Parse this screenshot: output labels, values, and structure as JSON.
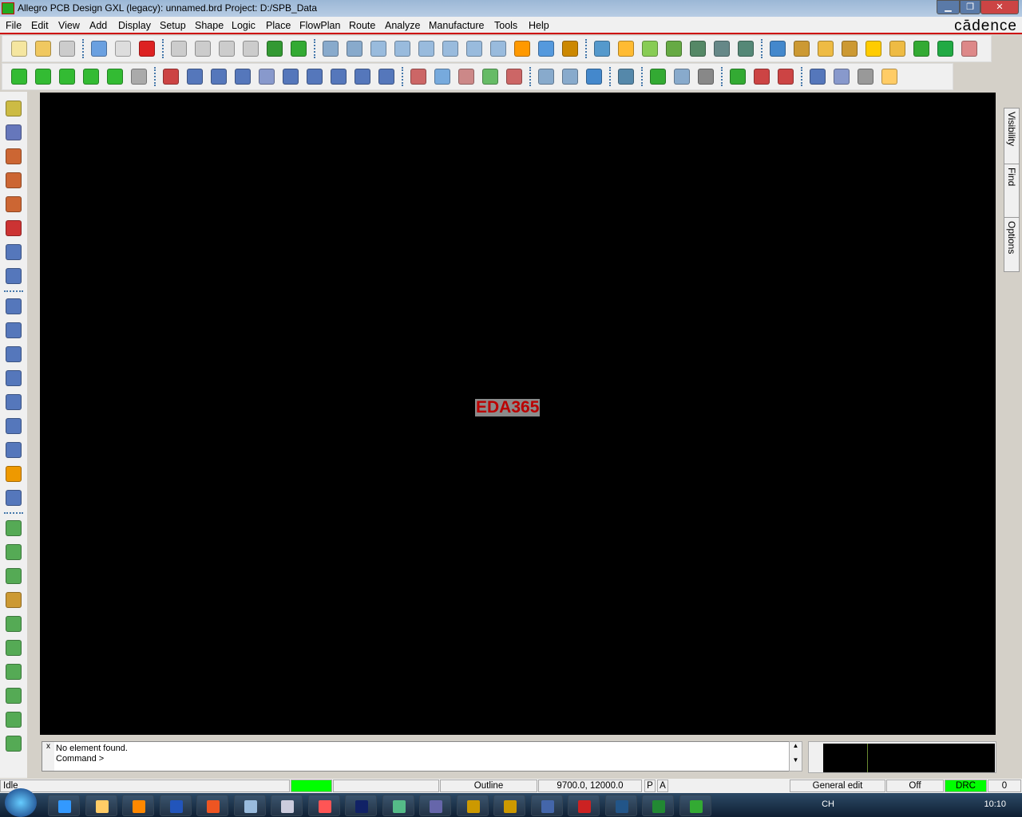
{
  "window": {
    "title": "Allegro PCB Design GXL (legacy): unnamed.brd  Project: D:/SPB_Data",
    "brand": "cādence",
    "minimize": "▁",
    "maximize": "❐",
    "close": "✕"
  },
  "menu": [
    "File",
    "Edit",
    "View",
    "Add",
    "Display",
    "Setup",
    "Shape",
    "Logic",
    "Place",
    "FlowPlan",
    "Route",
    "Analyze",
    "Manufacture",
    "Tools",
    "Help"
  ],
  "toolbar1": [
    [
      "new-icon",
      "#f5e6a0"
    ],
    [
      "open-icon",
      "#f0c860"
    ],
    [
      "save-icon",
      "#ccc"
    ],
    "|",
    [
      "move-icon",
      "#6aa0e0"
    ],
    [
      "copy-icon",
      "#ddd"
    ],
    [
      "delete-icon",
      "#d22"
    ],
    "|",
    [
      "undo-icon",
      "#ccc"
    ],
    [
      "undo-to-icon",
      "#ccc"
    ],
    [
      "redo-icon",
      "#ccc"
    ],
    [
      "redo-to-icon",
      "#ccc"
    ],
    [
      "ratsnest-icon",
      "#393"
    ],
    [
      "pin-icon",
      "#3a3"
    ],
    "|",
    [
      "grid-icon",
      "#8ac"
    ],
    [
      "zoom-fit-icon",
      "#8ac"
    ],
    [
      "zoom-points-icon",
      "#9bd"
    ],
    [
      "zoom-window-icon",
      "#9bd"
    ],
    [
      "zoom-in-icon",
      "#9bd"
    ],
    [
      "zoom-out-icon",
      "#9bd"
    ],
    [
      "zoom-previous-icon",
      "#9bd"
    ],
    [
      "zoom-world-icon",
      "#9bd"
    ],
    [
      "redraw-icon",
      "#f90"
    ],
    [
      "3d-view-icon",
      "#59d"
    ],
    [
      "flip-icon",
      "#c80"
    ],
    "|",
    [
      "grid-toggle-icon",
      "#59c"
    ],
    [
      "color-icon",
      "#fb3"
    ],
    [
      "layer-icon",
      "#8c5"
    ],
    [
      "layers-stack-icon",
      "#6a4"
    ],
    [
      "ecm-icon",
      "#586"
    ],
    [
      "dfa-icon",
      "#688"
    ],
    [
      "world-icon",
      "#587"
    ],
    "|",
    [
      "info-icon",
      "#48c"
    ],
    [
      "properties-icon",
      "#c93"
    ],
    [
      "measure-icon",
      "#eb4"
    ],
    [
      "clean-icon",
      "#c93"
    ],
    [
      "highlight-icon",
      "#fc0"
    ],
    [
      "dehighlight-icon",
      "#eb4"
    ],
    [
      "bars-icon",
      "#3a3"
    ],
    [
      "hourglass-icon",
      "#2a4"
    ],
    [
      "cursor-icon",
      "#d88"
    ]
  ],
  "toolbar2": [
    [
      "shape-add-icon",
      "#3b3"
    ],
    [
      "shape-edit-icon",
      "#3b3"
    ],
    [
      "shape-void-icon",
      "#3b3"
    ],
    [
      "shape-merge-icon",
      "#3b3"
    ],
    [
      "shape-select-icon",
      "#3b3"
    ],
    [
      "shape-disabled-icon",
      "#aaa"
    ],
    "|",
    [
      "delete-pin-icon",
      "#c44"
    ],
    [
      "line-icon",
      "#57b"
    ],
    [
      "rectangle-icon",
      "#57b"
    ],
    [
      "circle-icon",
      "#57b"
    ],
    [
      "select-icon",
      "#89c"
    ],
    [
      "frect-icon",
      "#57b"
    ],
    [
      "arc-icon",
      "#57b"
    ],
    [
      "square-icon",
      "#57b"
    ],
    [
      "circle2-icon",
      "#57b"
    ],
    [
      "poly-icon",
      "#57b"
    ],
    "|",
    [
      "clipboard-icon",
      "#c66"
    ],
    [
      "book-icon",
      "#7ad"
    ],
    [
      "gift-icon",
      "#c88"
    ],
    [
      "check-icon",
      "#6b6"
    ],
    [
      "pencil-icon",
      "#c66"
    ],
    "|",
    [
      "layers-icon",
      "#8ac"
    ],
    [
      "mail-icon",
      "#8ac"
    ],
    [
      "help-icon",
      "#48c"
    ],
    "|",
    [
      "wave-icon",
      "#58a"
    ],
    "|",
    [
      "place-icon",
      "#3a3"
    ],
    [
      "u1-icon",
      "#8ac"
    ],
    [
      "connector-icon",
      "#888"
    ],
    "|",
    [
      "package-icon",
      "#3a3"
    ],
    [
      "dim-icon",
      "#c44"
    ],
    [
      "dim2-icon",
      "#c44"
    ],
    "|",
    [
      "diag-line-icon",
      "#57b"
    ],
    [
      "box-icon",
      "#89c"
    ],
    [
      "text-add-icon",
      "#999"
    ],
    [
      "text-edit-icon",
      "#fc6"
    ]
  ],
  "lefttools": [
    [
      "route-icon",
      "#cb4"
    ],
    [
      "slide-icon",
      "#67b"
    ],
    [
      "delay-tune-icon",
      "#c63"
    ],
    [
      "fanout-icon",
      "#c63"
    ],
    [
      "custom-smooth-icon",
      "#c63"
    ],
    [
      "spread-icon",
      "#c33"
    ],
    [
      "glossing-icon",
      "#57b"
    ],
    [
      "tune-icon",
      "#57b"
    ],
    "|",
    [
      "odb-icon",
      "#57b"
    ],
    [
      "book-icon",
      "#57b"
    ],
    [
      "wrench-icon",
      "#57b"
    ],
    [
      "camera-icon",
      "#57b"
    ],
    [
      "refdes-icon",
      "#57b"
    ],
    [
      "library-icon",
      "#57b"
    ],
    [
      "grid-icon",
      "#57b"
    ],
    [
      "testpoint-icon",
      "#e90"
    ],
    [
      "array-icon",
      "#57b"
    ],
    "|",
    [
      "connect-icon",
      "#5a5"
    ],
    [
      "connect2-icon",
      "#5a5"
    ],
    [
      "connect3-icon",
      "#5a5"
    ],
    [
      "diff-pair-icon",
      "#c93"
    ],
    [
      "square-connect-icon",
      "#5a5"
    ],
    [
      "cross-icon",
      "#5a5"
    ],
    [
      "trace-icon",
      "#5a5"
    ],
    [
      "bus-icon",
      "#5a5"
    ],
    [
      "table-icon",
      "#5a5"
    ],
    [
      "nets-icon",
      "#5a5"
    ]
  ],
  "canvas": {
    "text": "EDA365"
  },
  "side_tabs": [
    "Visibility",
    "Find",
    "Options"
  ],
  "command": {
    "line1": "No element found.",
    "line2": "Command >",
    "close": "x"
  },
  "status": {
    "state": "Idle",
    "layer": "Outline",
    "coords": "9700.0, 12000.0",
    "p": "P",
    "a": "A",
    "mode": "General edit",
    "off": "Off",
    "drc": "DRC",
    "count": "0",
    "indicator_color": "#00ff00"
  },
  "taskbar": {
    "icons": [
      [
        "ie-icon",
        "#39f"
      ],
      [
        "folder-icon",
        "#fc6"
      ],
      [
        "media-icon",
        "#f80"
      ],
      [
        "word-icon",
        "#25b"
      ],
      [
        "pinwheel-icon",
        "#e52"
      ],
      [
        "calculator-icon",
        "#9bd"
      ],
      [
        "notepad-icon",
        "#ccd"
      ],
      [
        "viewer-icon",
        "#f55"
      ],
      [
        "photoshop-icon",
        "#126"
      ],
      [
        "network-icon",
        "#5b8"
      ],
      [
        "tool-icon",
        "#66a"
      ],
      [
        "pads-icon",
        "#c90"
      ],
      [
        "pads2-icon",
        "#c90"
      ],
      [
        "allegro-icon",
        "#46a"
      ],
      [
        "cad-icon",
        "#c22"
      ],
      [
        "app-icon",
        "#258"
      ],
      [
        "excel-icon",
        "#283"
      ],
      [
        "allegro-pcb-icon",
        "#3a3"
      ]
    ],
    "lang": "CH",
    "time": "10:10"
  }
}
